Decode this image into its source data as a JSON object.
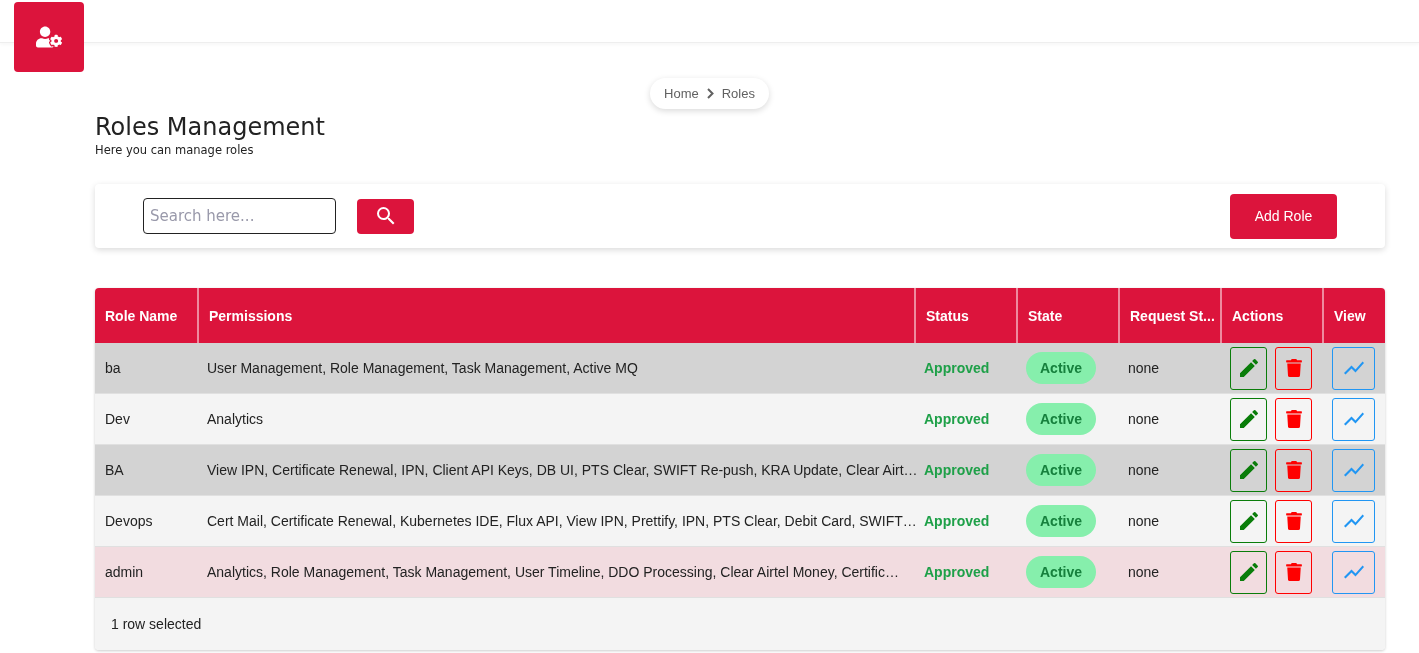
{
  "breadcrumb": [
    "Home",
    "Roles"
  ],
  "page": {
    "title": "Roles Management",
    "subtitle": "Here you can manage roles"
  },
  "search": {
    "placeholder": "Search here..."
  },
  "add_button": "Add Role",
  "table": {
    "columns": [
      "Role Name",
      "Permissions",
      "Status",
      "State",
      "Request St...",
      "Actions",
      "View"
    ],
    "rows": [
      {
        "name": "ba",
        "permissions": "User Management, Role Management, Task Management, Active MQ",
        "status": "Approved",
        "state": "Active",
        "request_status": "none",
        "selected": false
      },
      {
        "name": "Dev",
        "permissions": "Analytics",
        "status": "Approved",
        "state": "Active",
        "request_status": "none",
        "selected": false
      },
      {
        "name": "BA",
        "permissions": "View IPN, Certificate Renewal, IPN, Client API Keys, DB UI, PTS Clear, SWIFT Re-push, KRA Update, Clear Airt…",
        "status": "Approved",
        "state": "Active",
        "request_status": "none",
        "selected": false
      },
      {
        "name": "Devops",
        "permissions": "Cert Mail, Certificate Renewal, Kubernetes IDE, Flux API, View IPN, Prettify, IPN, PTS Clear, Debit Card, SWIFT…",
        "status": "Approved",
        "state": "Active",
        "request_status": "none",
        "selected": false
      },
      {
        "name": "admin",
        "permissions": "Analytics, Role Management, Task Management, User Timeline, DDO Processing, Clear Airtel Money, Certific…",
        "status": "Approved",
        "state": "Active",
        "request_status": "none",
        "selected": true
      }
    ],
    "footer": "1 row selected"
  }
}
